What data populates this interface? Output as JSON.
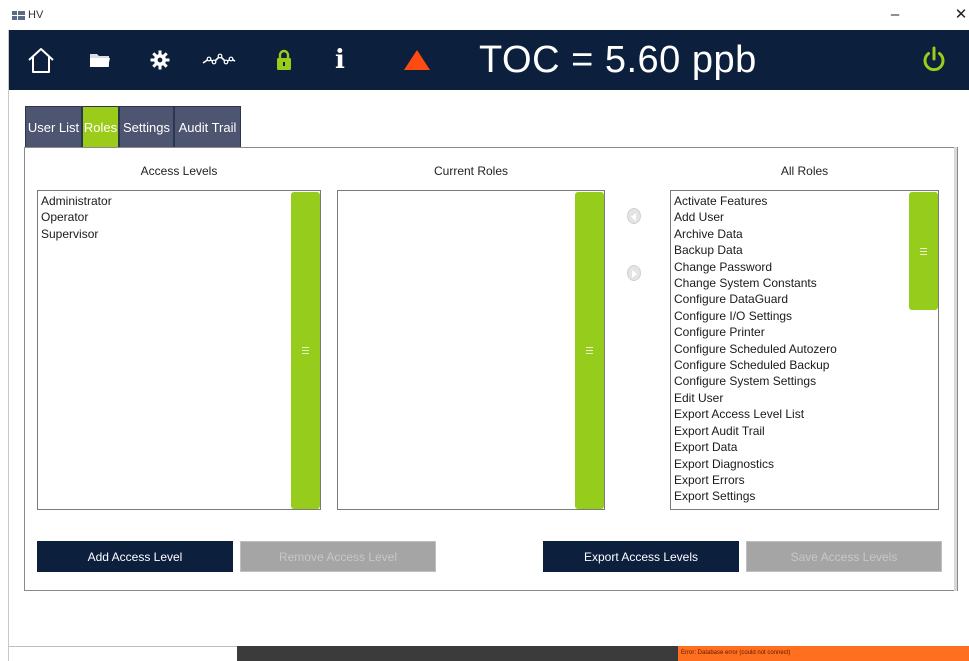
{
  "window": {
    "title": "HV",
    "minimize": "–",
    "close": "✕"
  },
  "toolbar": {
    "icons": [
      "home-icon",
      "folder-icon",
      "gear-icon",
      "trend-icon",
      "lock-icon",
      "info-icon",
      "alarm-triangle-icon",
      "power-icon"
    ],
    "info_glyph": "i",
    "toc_reading": "TOC = 5.60 ppb",
    "colors": {
      "bar": "#0c1f3c",
      "accent": "#9ccc1a",
      "alarm": "#ff4a10"
    }
  },
  "tabs": [
    {
      "label": "User List",
      "active": false
    },
    {
      "label": "Roles",
      "active": true
    },
    {
      "label": "Settings",
      "active": false
    },
    {
      "label": "Audit Trail",
      "active": false
    }
  ],
  "access_levels": {
    "header": "Access Levels",
    "items": [
      "Administrator",
      "Operator",
      "Supervisor"
    ]
  },
  "current_roles": {
    "header": "Current Roles",
    "items": []
  },
  "all_roles": {
    "header": "All Roles",
    "items": [
      "Activate Features",
      "Add User",
      "Archive Data",
      "Backup Data",
      "Change Password",
      "Change System Constants",
      "Configure DataGuard",
      "Configure I/O Settings",
      "Configure Printer",
      "Configure Scheduled Autozero",
      "Configure Scheduled Backup",
      "Configure System Settings",
      "Edit User",
      "Export Access Level List",
      "Export Audit Trail",
      "Export Data",
      "Export Diagnostics",
      "Export Errors",
      "Export Settings"
    ]
  },
  "buttons": {
    "add_access_level": "Add Access Level",
    "remove_access_level": "Remove Access Level",
    "export_access_levels": "Export Access Levels",
    "save_access_levels": "Save Access Levels"
  },
  "status": {
    "error_text": "Error: Database error (could not connect)"
  }
}
